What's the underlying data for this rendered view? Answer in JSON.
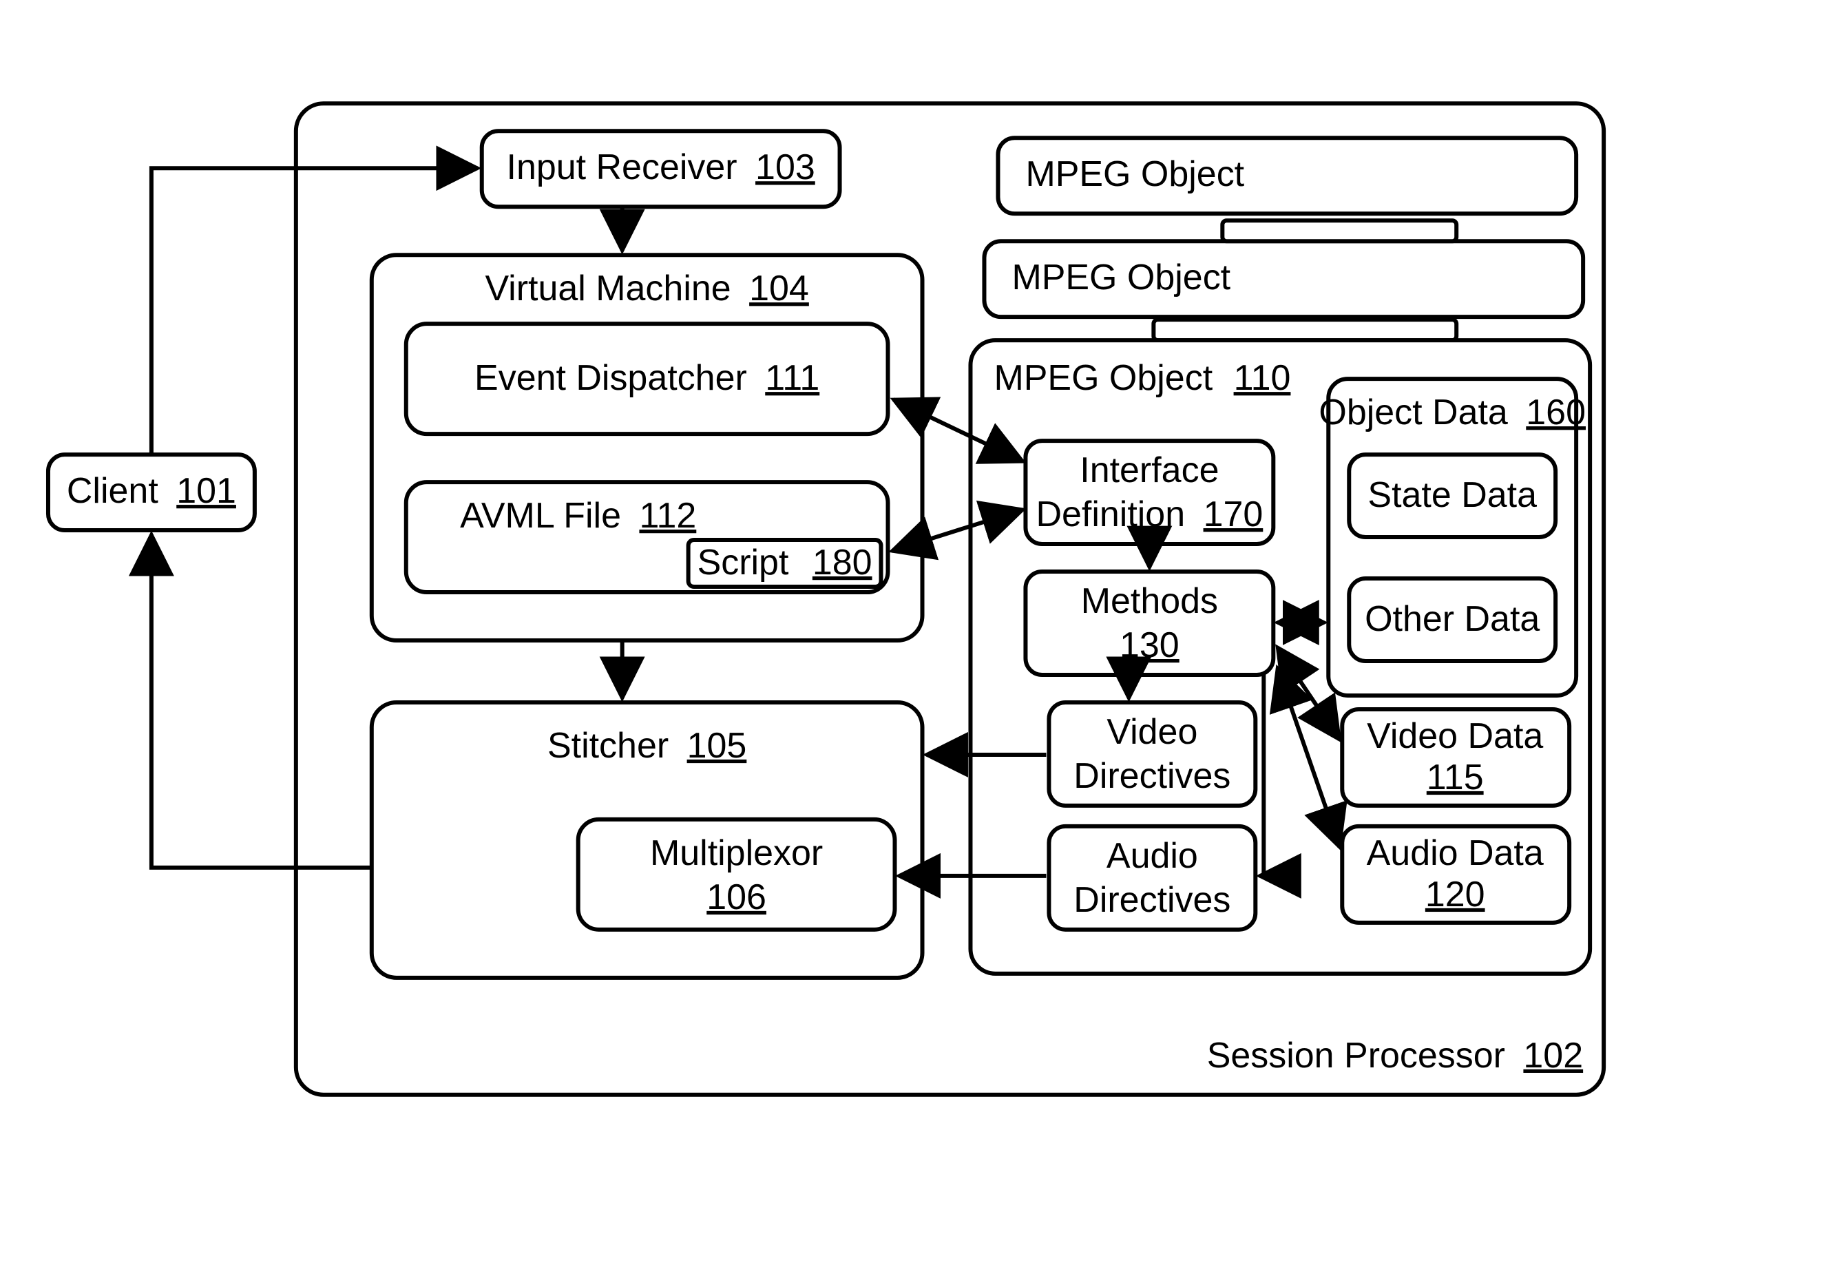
{
  "client": {
    "label": "Client",
    "ref": "101"
  },
  "session": {
    "label": "Session Processor",
    "ref": "102"
  },
  "inputReceiver": {
    "label": "Input Receiver",
    "ref": "103"
  },
  "virtualMachine": {
    "label": "Virtual Machine",
    "ref": "104"
  },
  "eventDispatcher": {
    "label": "Event Dispatcher",
    "ref": "111"
  },
  "avmlFile": {
    "label": "AVML File",
    "ref": "112"
  },
  "script": {
    "label": "Script",
    "ref": "180"
  },
  "stitcher": {
    "label": "Stitcher",
    "ref": "105"
  },
  "multiplexor": {
    "label": "Multiplexor",
    "ref": "106"
  },
  "mpegObjectBg1": {
    "label": "MPEG Object"
  },
  "mpegObjectBg2": {
    "label": "MPEG Object"
  },
  "mpegObject": {
    "label": "MPEG Object",
    "ref": "110"
  },
  "interfaceDef": {
    "label": "Interface",
    "label2": "Definition",
    "ref": "170"
  },
  "methods": {
    "label": "Methods",
    "ref": "130"
  },
  "videoDirectives": {
    "label": "Video",
    "label2": "Directives"
  },
  "audioDirectives": {
    "label": "Audio",
    "label2": "Directives"
  },
  "objectData": {
    "label": "Object Data",
    "ref": "160"
  },
  "stateData": {
    "label": "State Data"
  },
  "otherData": {
    "label": "Other Data"
  },
  "videoData": {
    "label": "Video Data",
    "ref": "115"
  },
  "audioData": {
    "label": "Audio Data",
    "ref": "120"
  }
}
